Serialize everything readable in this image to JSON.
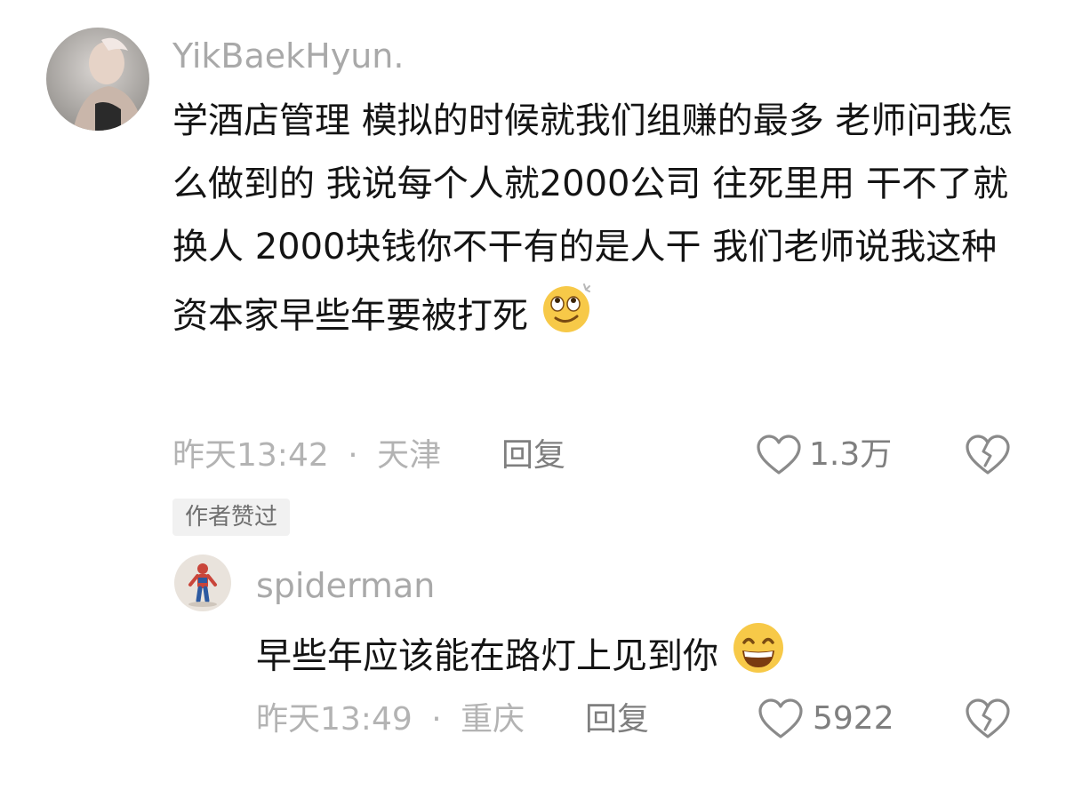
{
  "comment": {
    "username": "YikBaekHyun.",
    "text": "学酒店管理 模拟的时候就我们组赚的最多 老师问我怎么做到的 我说每个人就2000公司 往死里用 干不了就换人 2000块钱你不干有的是人干 我们老师说我这种资本家早些年要被打死",
    "emoji": "rolling-eyes-emoji",
    "time": "昨天13:42",
    "separator": "·",
    "location": "天津",
    "reply_label": "回复",
    "likes": "1.3万",
    "badge": "作者赞过"
  },
  "reply": {
    "username": "spiderman",
    "text": "早些年应该能在路灯上见到你",
    "emoji": "grinning-emoji",
    "time": "昨天13:49",
    "separator": "·",
    "location": "重庆",
    "reply_label": "回复",
    "likes": "5922"
  },
  "colors": {
    "username": "#a9a9a9",
    "body_text": "#141414",
    "meta": "#b3b3b3",
    "action": "#7f7f7f",
    "badge_bg": "#f1f1f1",
    "emoji_yellow": "#f7c948"
  }
}
